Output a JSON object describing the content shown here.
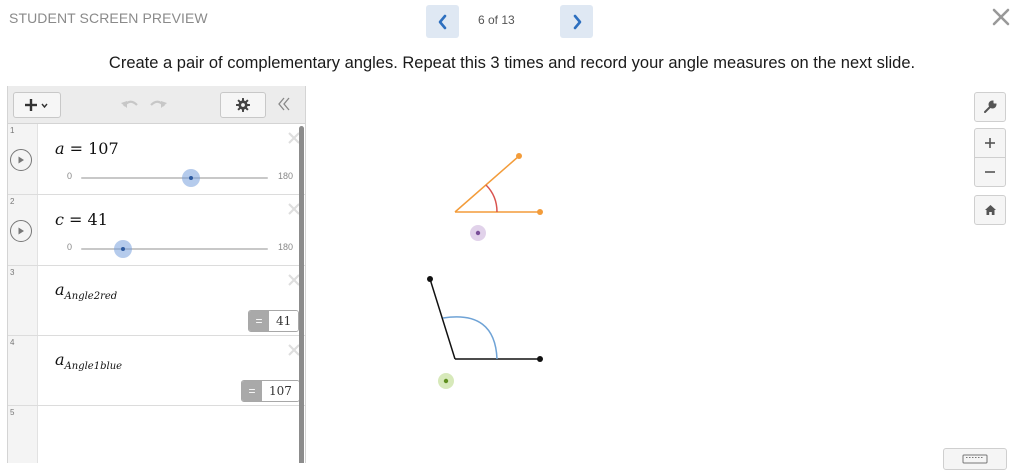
{
  "header": {
    "preview_label": "STUDENT SCREEN PREVIEW",
    "page_count": "6 of 13"
  },
  "instruction": "Create a pair of complementary angles. Repeat this 3 times and record your angle measures on the next slide.",
  "expressions": [
    {
      "number": "1",
      "variable": "a",
      "equals": " = ",
      "value": "107",
      "slider": {
        "min": "0",
        "max": "180",
        "current": 107
      }
    },
    {
      "number": "2",
      "variable": "c",
      "equals": " = ",
      "value": "41",
      "slider": {
        "min": "0",
        "max": "180",
        "current": 41
      }
    },
    {
      "number": "3",
      "variable": "a",
      "subscript": "Angle2red",
      "eval_equals": "=",
      "eval_value": "41"
    },
    {
      "number": "4",
      "variable": "a",
      "subscript": "Angle1blue",
      "eval_equals": "=",
      "eval_value": "107"
    },
    {
      "number": "5"
    }
  ],
  "colors": {
    "orange": "#f39c3a",
    "red_arc": "#d9534f",
    "blue_arc": "#6fa3d6",
    "black": "#111111",
    "purple_point": "#9b6ab8",
    "green_point": "#8cc03a"
  },
  "icons": {
    "prev": "chevron-left-icon",
    "next": "chevron-right-icon",
    "close": "close-icon",
    "add": "plus-icon",
    "settings": "gear-icon",
    "wrench": "wrench-icon",
    "zoom_in": "plus-icon",
    "zoom_out": "minus-icon",
    "home": "home-icon",
    "keyboard": "keyboard-icon"
  }
}
